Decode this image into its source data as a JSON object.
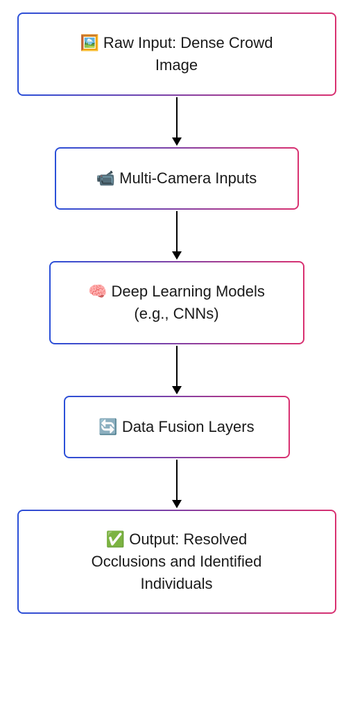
{
  "chart_data": {
    "type": "flowchart",
    "direction": "top-to-bottom",
    "nodes": [
      {
        "id": "n1",
        "icon": "🖼️",
        "lines": [
          "Raw Input: Dense Crowd",
          "Image"
        ]
      },
      {
        "id": "n2",
        "icon": "📹",
        "lines": [
          "Multi-Camera Inputs"
        ]
      },
      {
        "id": "n3",
        "icon": "🧠",
        "lines": [
          "Deep Learning Models",
          "(e.g., CNNs)"
        ]
      },
      {
        "id": "n4",
        "icon": "🔄",
        "lines": [
          "Data Fusion Layers"
        ]
      },
      {
        "id": "n5",
        "icon": "✅",
        "lines": [
          "Output: Resolved",
          "Occlusions and Identified",
          "Individuals"
        ]
      }
    ],
    "edges": [
      {
        "from": "n1",
        "to": "n2"
      },
      {
        "from": "n2",
        "to": "n3"
      },
      {
        "from": "n3",
        "to": "n4"
      },
      {
        "from": "n4",
        "to": "n5"
      }
    ],
    "style": {
      "border_gradient": [
        "#2a4fd8",
        "#d93070"
      ],
      "arrow_color": "#000000",
      "background": "#ffffff"
    }
  }
}
